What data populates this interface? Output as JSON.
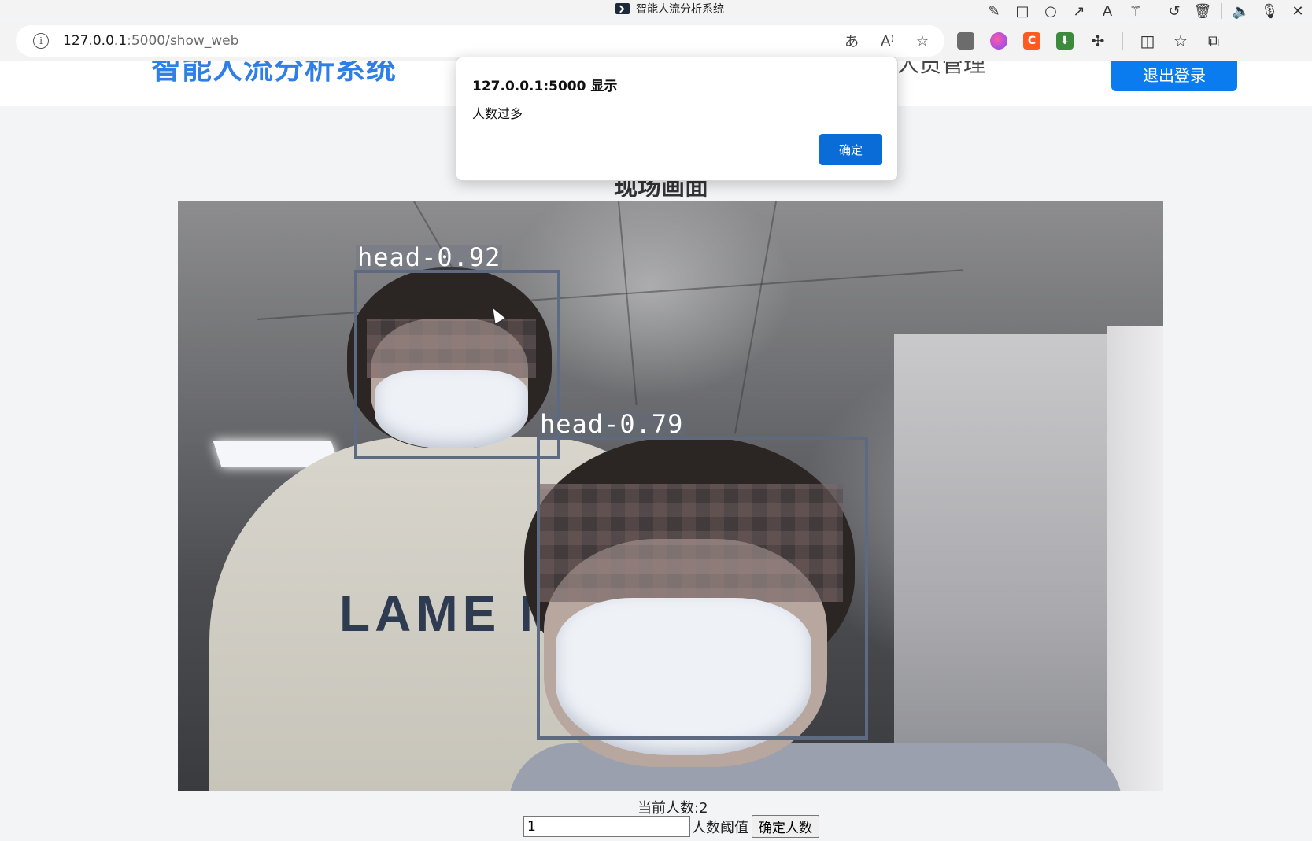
{
  "window": {
    "title": "智能人流分析系统"
  },
  "toolbar": {
    "tools": [
      "pencil-icon",
      "square-icon",
      "circle-icon",
      "arrow-icon",
      "text-icon",
      "magic-wand-icon",
      "undo-icon",
      "trash-icon",
      "speaker-icon",
      "microphone-icon",
      "close-icon"
    ]
  },
  "address_bar": {
    "host": "127.0.0.1",
    "path": ":5000/show_web"
  },
  "header": {
    "brand": "智能人流分析系统",
    "nav_item": "人员管理",
    "logout_label": "退出登录"
  },
  "main": {
    "section_title": "现场画面",
    "detections": [
      {
        "label": "head",
        "score": "0.92"
      },
      {
        "label": "head",
        "score": "0.79"
      }
    ],
    "hoodie_text": "LAME M",
    "count_text": "当前人数:2",
    "threshold_value": "1",
    "threshold_label": "人数阈值",
    "confirm_label": "确定人数"
  },
  "dialog": {
    "title": "127.0.0.1:5000 显示",
    "message": "人数过多",
    "ok_label": "确定"
  },
  "colors": {
    "accent": "#0a7cf0",
    "brand": "#2f7fe6",
    "detection_box": "#5e6a82",
    "dialog_button": "#0a6cd6"
  }
}
